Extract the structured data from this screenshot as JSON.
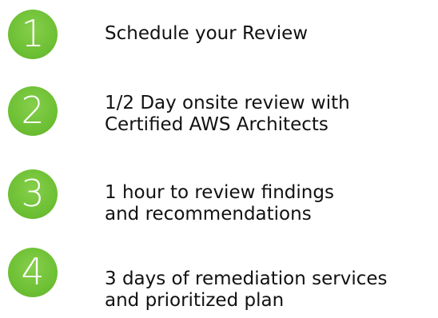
{
  "accent_color": "#6cbf33",
  "steps": [
    {
      "number": "1",
      "lines": [
        "Schedule your Review"
      ]
    },
    {
      "number": "2",
      "lines": [
        "1/2 Day onsite review with",
        "Certified AWS Architects"
      ]
    },
    {
      "number": "3",
      "lines": [
        "1 hour to review findings",
        "and recommendations"
      ]
    },
    {
      "number": "4",
      "lines": [
        "3 days of remediation services",
        "and prioritized plan"
      ]
    }
  ]
}
